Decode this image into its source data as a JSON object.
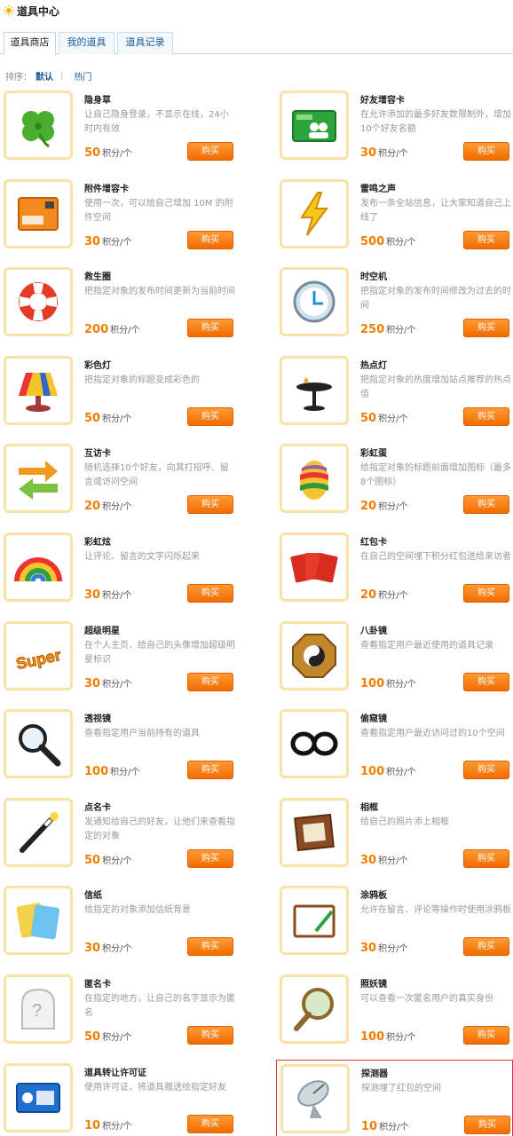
{
  "header": {
    "title": "道具中心",
    "icon": "sun-icon"
  },
  "tabs": [
    {
      "label": "道具商店",
      "active": true
    },
    {
      "label": "我的道具",
      "active": false
    },
    {
      "label": "道具记录",
      "active": false
    }
  ],
  "sort": {
    "label": "排序：",
    "options": [
      "默认",
      "热门"
    ],
    "selected": "默认"
  },
  "unit": "积分/个",
  "buy_label": "购买",
  "items": [
    {
      "name": "隐身草",
      "desc": "让自己隐身登录，不显示在线，24小时内有效",
      "price": "50",
      "icon": "clover-icon"
    },
    {
      "name": "好友增容卡",
      "desc": "在允许添加的最多好友数限制外，增加10个好友名额",
      "price": "30",
      "icon": "friend-card-icon"
    },
    {
      "name": "附件增容卡",
      "desc": "使用一次，可以给自己增加 10M 的附件空间",
      "price": "30",
      "icon": "attachment-card-icon"
    },
    {
      "name": "雷鸣之声",
      "desc": "发布一条全站信息，让大家知道自己上线了",
      "price": "500",
      "icon": "lightning-icon"
    },
    {
      "name": "救生圈",
      "desc": "把指定对象的发布时间更新为当前时间",
      "price": "200",
      "icon": "lifebuoy-icon"
    },
    {
      "name": "时空机",
      "desc": "把指定对象的发布时间修改为过去的时间",
      "price": "250",
      "icon": "clock-icon"
    },
    {
      "name": "彩色灯",
      "desc": "把指定对象的标题变成彩色的",
      "price": "50",
      "icon": "rainbow-lamp-icon"
    },
    {
      "name": "热点灯",
      "desc": "把指定对象的热度增加站点推荐的热点值",
      "price": "50",
      "icon": "hot-lamp-icon"
    },
    {
      "name": "互访卡",
      "desc": "随机选择10个好友，向其打招呼、留言或访问空间",
      "price": "20",
      "icon": "exchange-arrows-icon"
    },
    {
      "name": "彩虹蛋",
      "desc": "给指定对象的标题前面增加图标（最多8个图标）",
      "price": "20",
      "icon": "rainbow-egg-icon"
    },
    {
      "name": "彩虹炫",
      "desc": "让评论、留言的文字闪烁起来",
      "price": "30",
      "icon": "rainbow-icon"
    },
    {
      "name": "红包卡",
      "desc": "在自己的空间埋下积分红包送给来访者",
      "price": "20",
      "icon": "red-envelope-icon"
    },
    {
      "name": "超级明星",
      "desc": "在个人主页，给自己的头像增加超级明星标识",
      "price": "30",
      "icon": "super-star-icon"
    },
    {
      "name": "八卦镜",
      "desc": "查看指定用户最近使用的道具记录",
      "price": "100",
      "icon": "bagua-mirror-icon"
    },
    {
      "name": "透视镜",
      "desc": "查看指定用户当前持有的道具",
      "price": "100",
      "icon": "magnifier-icon"
    },
    {
      "name": "偷窥镜",
      "desc": "查看指定用户最近访问过的10个空间",
      "price": "100",
      "icon": "glasses-icon"
    },
    {
      "name": "点名卡",
      "desc": "发通知给自己的好友，让他们来查看指定的对象",
      "price": "50",
      "icon": "magic-wand-icon"
    },
    {
      "name": "相框",
      "desc": "给自己的照片添上相框",
      "price": "30",
      "icon": "photo-frame-icon"
    },
    {
      "name": "信纸",
      "desc": "给指定的对象添加信纸背景",
      "price": "30",
      "icon": "letter-paper-icon"
    },
    {
      "name": "涂鸦板",
      "desc": "允许在留言、评论等操作时使用涂鸦板",
      "price": "30",
      "icon": "sketchpad-icon"
    },
    {
      "name": "匿名卡",
      "desc": "在指定的地方，让自己的名字显示为匿名",
      "price": "50",
      "icon": "anonymous-icon"
    },
    {
      "name": "照妖镜",
      "desc": "可以查看一次匿名用户的真实身份",
      "price": "100",
      "icon": "hand-mirror-icon"
    },
    {
      "name": "道具转让许可证",
      "desc": "使用许可证，将道具赠送给指定好友",
      "price": "10",
      "icon": "transfer-license-icon"
    },
    {
      "name": "探测器",
      "desc": "探测埋了红包的空间",
      "price": "10",
      "icon": "radar-dish-icon"
    }
  ]
}
